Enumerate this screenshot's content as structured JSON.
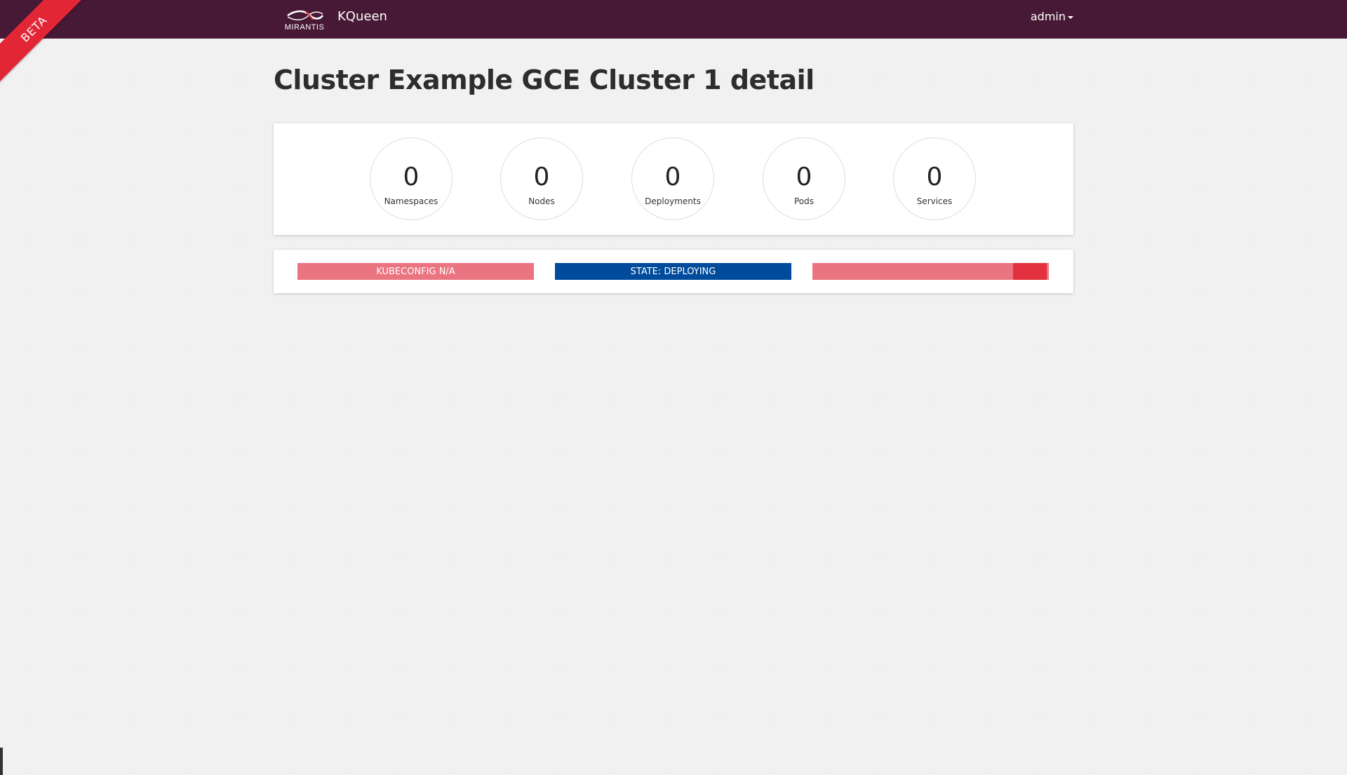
{
  "header": {
    "logo_text": "MIRANTIS",
    "app_title": "KQueen",
    "user_label": "admin",
    "background_color": "#471936"
  },
  "ribbon": {
    "label": "BETA",
    "color": "#e32636"
  },
  "page": {
    "title": "Cluster Example GCE Cluster 1 detail"
  },
  "stats": [
    {
      "value": "0",
      "label": "Namespaces"
    },
    {
      "value": "0",
      "label": "Nodes"
    },
    {
      "value": "0",
      "label": "Deployments"
    },
    {
      "value": "0",
      "label": "Pods"
    },
    {
      "value": "0",
      "label": "Services"
    }
  ],
  "status": {
    "kubeconfig_label": "KUBECONFIG N/A",
    "kubeconfig_color": "#ea7480",
    "state_label": "STATE: DEPLOYING",
    "state_color": "#004b9b",
    "progress": {
      "fraction": 0.85,
      "fill_color": "#ea7480",
      "rest_color": "#e2303e"
    }
  }
}
